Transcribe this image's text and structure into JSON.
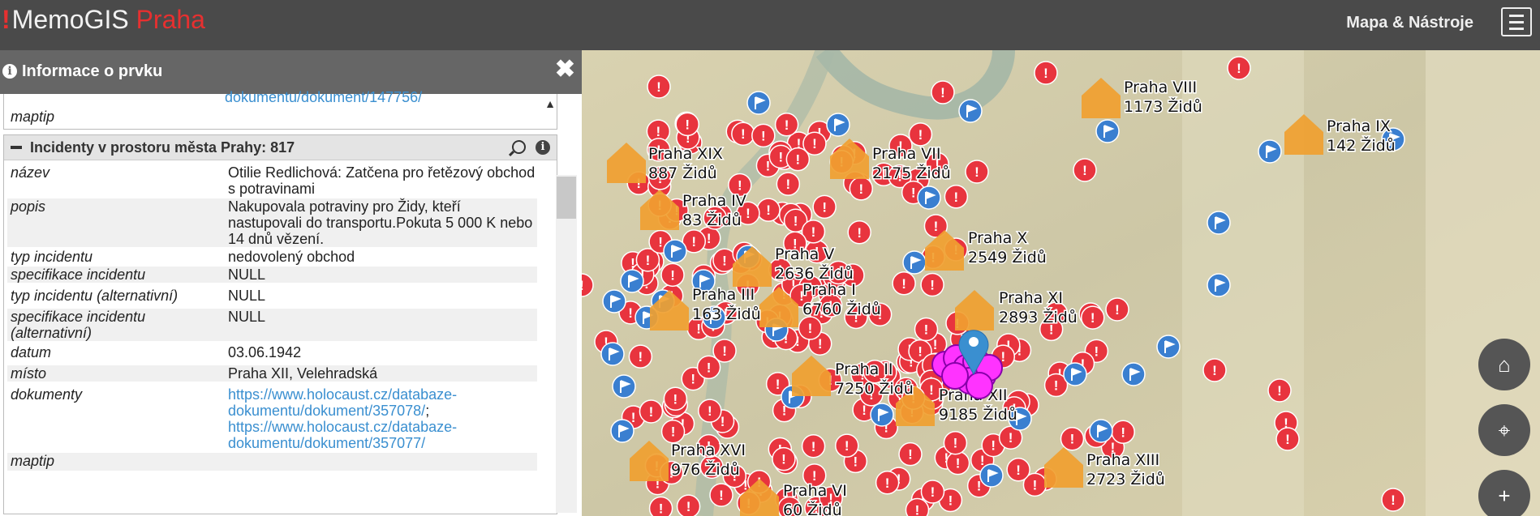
{
  "header": {
    "logo_mark": "!",
    "logo_text": "MemoGIS ",
    "logo_city": "Praha",
    "tools_label": "Mapa & Nástroje"
  },
  "panel": {
    "title": "Informace o prvku",
    "close": "✖",
    "prev_feature": {
      "link_partial": "dokumentu/dokument/147756/",
      "maptip_label": "maptip"
    },
    "layer_header": "Incidenty v prostoru města Prahy: 817",
    "rows": [
      {
        "key": "název",
        "value": "Otilie Redlichová: Zatčena pro řetězový obchod s potravinami"
      },
      {
        "key": "popis",
        "value": "Nakupovala potraviny pro Židy, kteří nastupovali do transportu.Pokuta 5 000 K nebo 14 dnů vězení."
      },
      {
        "key": "typ incidentu",
        "value": "nedovolený obchod"
      },
      {
        "key": "specifikace incidentu",
        "value": "NULL"
      },
      {
        "key": "typ incidentu (alternativní)",
        "value": "NULL"
      },
      {
        "key": "specifikace incidentu (alternativní)",
        "value": "NULL"
      },
      {
        "key": "datum",
        "value": "03.06.1942"
      },
      {
        "key": "místo",
        "value": "Praha XII, Velehradská"
      },
      {
        "key": "dokumenty",
        "link1": "https://www.holocaust.cz/databaze-dokumentu/dokument/357078/",
        "sep": ";",
        "link2": "https://www.holocaust.cz/databaze-dokumentu/dokument/357077/"
      },
      {
        "key": "maptip",
        "value": ""
      }
    ]
  },
  "map": {
    "districts": [
      {
        "name": "Praha XIX",
        "count": "887 Židů"
      },
      {
        "name": "Praha VII",
        "count": "2175 Židů"
      },
      {
        "name": "Praha VIII",
        "count": "1173 Židů"
      },
      {
        "name": "Praha IX",
        "count": "142 Židů"
      },
      {
        "name": "Praha IV",
        "count": "83 Židů"
      },
      {
        "name": "Praha X",
        "count": "2549 Židů"
      },
      {
        "name": "Praha V",
        "count": "2636 Židů"
      },
      {
        "name": "Praha III",
        "count": "163 Židů"
      },
      {
        "name": "Praha I",
        "count": "6760 Židů"
      },
      {
        "name": "Praha XI",
        "count": "2893 Židů"
      },
      {
        "name": "Praha II",
        "count": "7250 Židů"
      },
      {
        "name": "Praha XII",
        "count": "9185 Židů"
      },
      {
        "name": "Praha XVI",
        "count": "976 Židů"
      },
      {
        "name": "Praha XIII",
        "count": "2723 Židů"
      },
      {
        "name": "Praha VI",
        "count": "60 Židů"
      }
    ],
    "colors": {
      "incident": "#e8343e",
      "flag": "#3a7fd0",
      "house": "#f0a030",
      "selected": "#ff33ff",
      "marker": "#3a8fd0"
    },
    "controls": {
      "home_icon": "home-icon",
      "locate_icon": "crosshair-icon",
      "zoom_in_icon": "plus-icon"
    }
  }
}
